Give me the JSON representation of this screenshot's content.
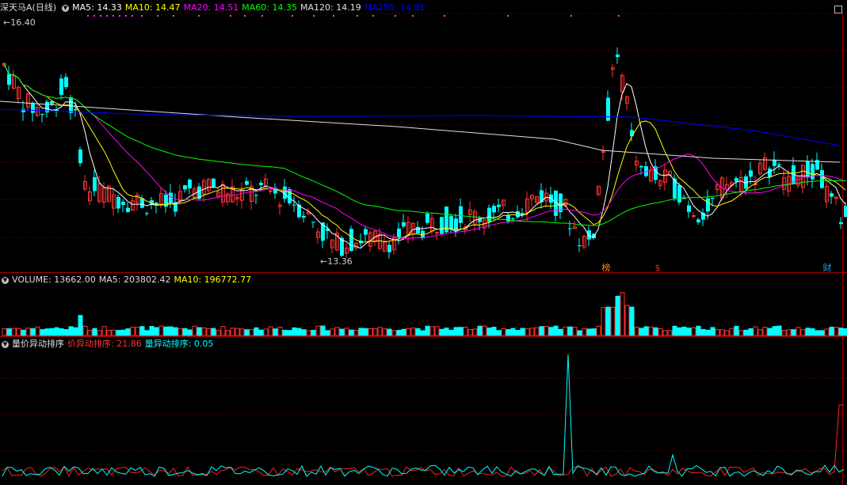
{
  "colors": {
    "up": "#ff3232",
    "down": "#00ffff",
    "bg": "#000000",
    "ma5": "#ffffff",
    "ma10": "#ffff00",
    "ma20": "#ff00ff",
    "ma60": "#00ff00",
    "ma120": "#e0e0e0",
    "ma250": "#0000ff",
    "grid": "#8b0000"
  },
  "price_panel": {
    "stock_name": "深天马A",
    "period": "(日线)",
    "dropdown_icon": "chevron-down-icon",
    "ma_labels": [
      {
        "text": "MA5: 14.33",
        "color": "#ffffff"
      },
      {
        "text": "MA10: 14.47",
        "color": "#ffff00"
      },
      {
        "text": "MA20: 14.51",
        "color": "#ff00ff"
      },
      {
        "text": "MA60: 14.35",
        "color": "#00ff00"
      },
      {
        "text": "MA120: 14.19",
        "color": "#e0e0e0"
      },
      {
        "text": "MA250: 14.81",
        "color": "#0000ff"
      }
    ],
    "high_label": "16.40",
    "low_label": "13.36",
    "markers": [
      {
        "text": "榜",
        "color": "#ff8800"
      },
      {
        "text": "$",
        "color": "#ff2020"
      },
      {
        "text": "财",
        "color": "#00aaff"
      }
    ]
  },
  "volume_panel": {
    "label": "VOLUME: 13662.00",
    "ma5": "MA5: 203802.42",
    "ma10": "MA10: 196772.77"
  },
  "indicator_panel": {
    "label": "量价异动排序",
    "price_label": "价异动排序: 21.86",
    "volume_label": "量异动排序: 0.05"
  }
}
